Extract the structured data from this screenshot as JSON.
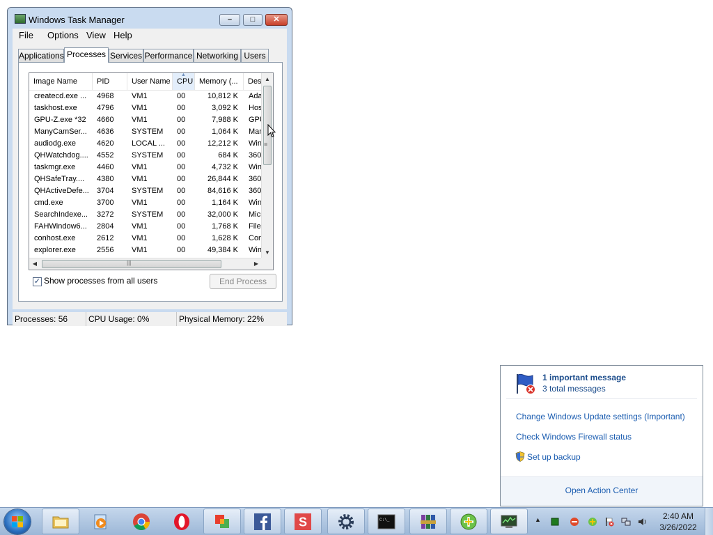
{
  "window": {
    "title": "Windows Task Manager",
    "menu": [
      "File",
      "Options",
      "View",
      "Help"
    ],
    "tabs": [
      "Applications",
      "Processes",
      "Services",
      "Performance",
      "Networking",
      "Users"
    ],
    "active_tab": "Processes"
  },
  "process_table": {
    "columns": [
      "Image Name",
      "PID",
      "User Name",
      "CPU",
      "Memory (...",
      "Des"
    ],
    "sorted_column": "CPU",
    "rows": [
      [
        "createcd.exe ...",
        "4968",
        "VM1",
        "00",
        "10,812 K",
        "Ada"
      ],
      [
        "taskhost.exe",
        "4796",
        "VM1",
        "00",
        "3,092 K",
        "Hos"
      ],
      [
        "GPU-Z.exe *32",
        "4660",
        "VM1",
        "00",
        "7,988 K",
        "GPU"
      ],
      [
        "ManyCamSer...",
        "4636",
        "SYSTEM",
        "00",
        "1,064 K",
        "Man"
      ],
      [
        "audiodg.exe",
        "4620",
        "LOCAL ...",
        "00",
        "12,212 K",
        "Win"
      ],
      [
        "QHWatchdog....",
        "4552",
        "SYSTEM",
        "00",
        "684 K",
        "360"
      ],
      [
        "taskmgr.exe",
        "4460",
        "VM1",
        "00",
        "4,732 K",
        "Win"
      ],
      [
        "QHSafeTray....",
        "4380",
        "VM1",
        "00",
        "26,844 K",
        "360"
      ],
      [
        "QHActiveDefe...",
        "3704",
        "SYSTEM",
        "00",
        "84,616 K",
        "360"
      ],
      [
        "cmd.exe",
        "3700",
        "VM1",
        "00",
        "1,164 K",
        "Win"
      ],
      [
        "SearchIndexe...",
        "3272",
        "SYSTEM",
        "00",
        "32,000 K",
        "Micr"
      ],
      [
        "FAHWindow6...",
        "2804",
        "VM1",
        "00",
        "1,768 K",
        "File"
      ],
      [
        "conhost.exe",
        "2612",
        "VM1",
        "00",
        "1,628 K",
        "Con"
      ],
      [
        "explorer.exe",
        "2556",
        "VM1",
        "00",
        "49,384 K",
        "Win"
      ]
    ]
  },
  "options": {
    "show_all_users_label": "Show processes from all users",
    "show_all_users_checked": true,
    "end_process_label": "End Process"
  },
  "status": {
    "processes": "Processes: 56",
    "cpu": "CPU Usage: 0%",
    "memory": "Physical Memory: 22%"
  },
  "action_center": {
    "important": "1 important message",
    "total": "3 total messages",
    "links": [
      "Change Windows Update settings (Important)",
      "Check Windows Firewall status",
      "Set up backup"
    ],
    "open_label": "Open Action Center"
  },
  "taskbar": {
    "pinned": [
      "windows-explorer",
      "media-player",
      "chrome",
      "opera",
      "office",
      "facebook",
      "s-app",
      "cheat-engine",
      "cmd",
      "winrar",
      "plus-app",
      "task-manager"
    ],
    "clock_time": "2:40 AM",
    "clock_date": "3/26/2022"
  }
}
